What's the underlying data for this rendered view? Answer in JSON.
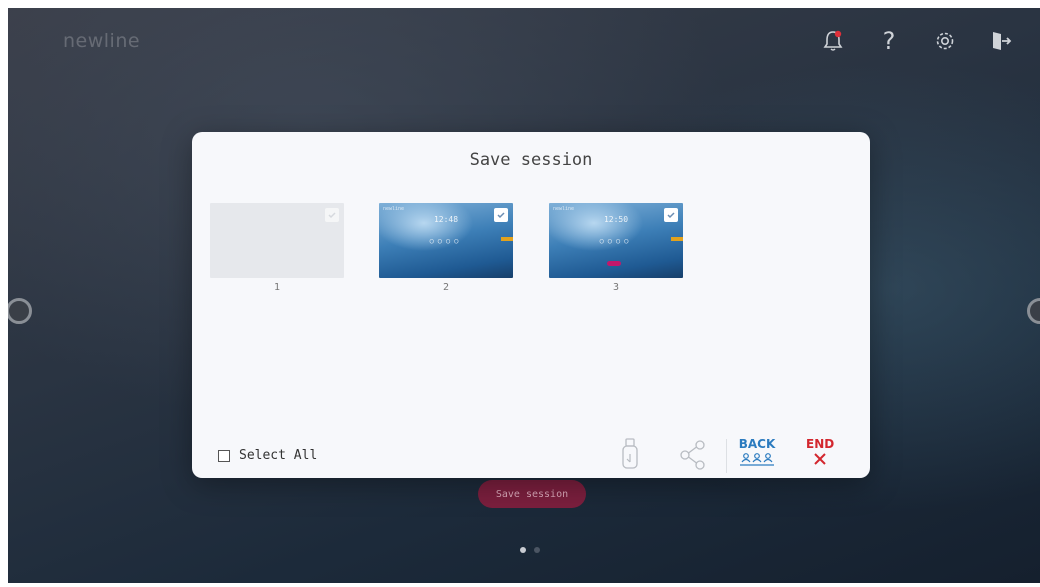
{
  "app": {
    "logo": "newline"
  },
  "topbar": {
    "icons": [
      "bell-icon",
      "help-icon",
      "settings-icon",
      "exit-icon"
    ],
    "help_glyph": "?",
    "notification_color": "#e0303a"
  },
  "dialog": {
    "title": "Save session",
    "thumbnails": [
      {
        "number": "1",
        "type": "blank",
        "checked": false
      },
      {
        "number": "2",
        "type": "screen",
        "checked": true,
        "time": "12:48"
      },
      {
        "number": "3",
        "type": "screen",
        "checked": true,
        "time": "12:50"
      }
    ],
    "select_all_label": "Select All",
    "actions": {
      "usb": "usb-icon",
      "share": "share-icon",
      "back_label": "BACK",
      "end_label": "END"
    }
  },
  "background": {
    "save_button_label": "Save session"
  },
  "pager": {
    "count": 2,
    "active": 0
  },
  "colors": {
    "accent_blue": "#2b7bbf",
    "end_red": "#d3272e",
    "save_pill": "#7b1f3e"
  }
}
